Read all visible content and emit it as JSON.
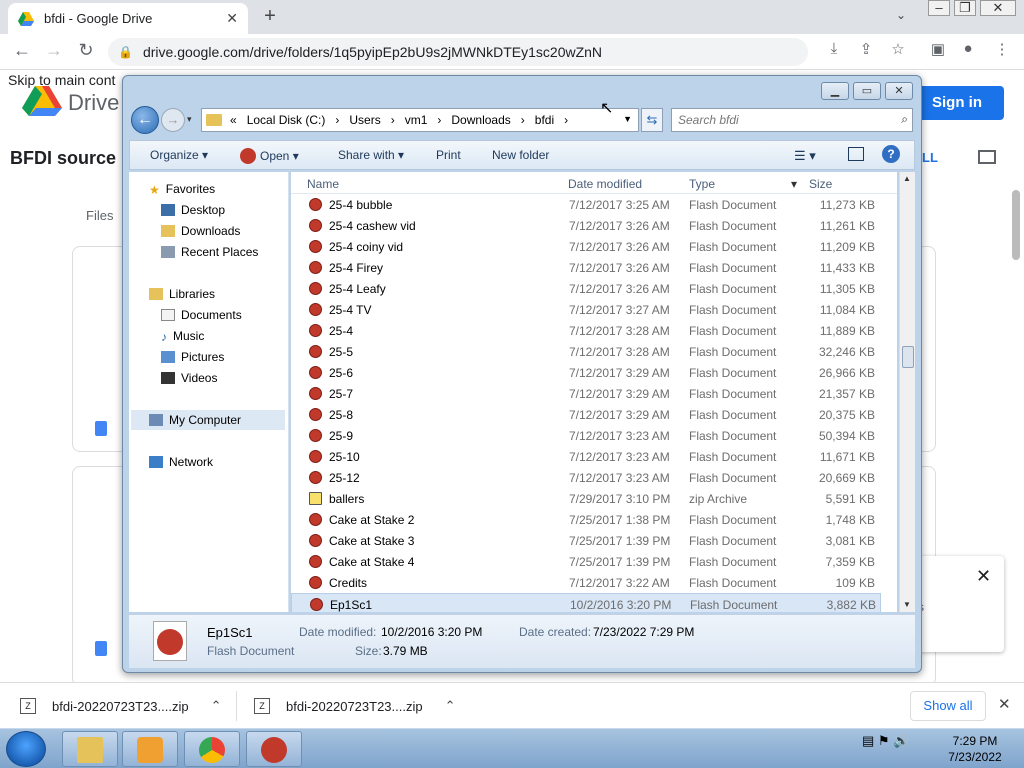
{
  "browser": {
    "tab_title": "bfdi - Google Drive",
    "url": "drive.google.com/drive/folders/1q5pyipEp2bU9s2jMWNkDTEy1sc20wZnN"
  },
  "drive": {
    "skip_link": "Skip to main cont",
    "logo_text": "Drive",
    "sign_in": "Sign in",
    "folder_title": "BFDI source",
    "files_label": "Files",
    "view_all": "LL",
    "popup_text": "s"
  },
  "downloads": {
    "items": [
      "bfdi-20220723T23....zip",
      "bfdi-20220723T23....zip"
    ],
    "show_all": "Show all"
  },
  "explorer": {
    "breadcrumb": [
      "Local Disk (C:)",
      "Users",
      "vm1",
      "Downloads",
      "bfdi"
    ],
    "search_placeholder": "Search bfdi",
    "commands": {
      "organize": "Organize ▾",
      "open": "Open ▾",
      "share": "Share with ▾",
      "print": "Print",
      "new_folder": "New folder"
    },
    "nav": {
      "favorites": "Favorites",
      "desktop": "Desktop",
      "downloads": "Downloads",
      "recent": "Recent Places",
      "libraries": "Libraries",
      "documents": "Documents",
      "music": "Music",
      "pictures": "Pictures",
      "videos": "Videos",
      "computer": "My Computer",
      "network": "Network"
    },
    "columns": {
      "name": "Name",
      "date": "Date modified",
      "type": "Type",
      "size": "Size"
    },
    "files": [
      {
        "name": "25-4 bubble",
        "date": "7/12/2017 3:25 AM",
        "type": "Flash Document",
        "size": "11,273 KB"
      },
      {
        "name": "25-4 cashew vid",
        "date": "7/12/2017 3:26 AM",
        "type": "Flash Document",
        "size": "11,261 KB"
      },
      {
        "name": "25-4 coiny vid",
        "date": "7/12/2017 3:26 AM",
        "type": "Flash Document",
        "size": "11,209 KB"
      },
      {
        "name": "25-4 Firey",
        "date": "7/12/2017 3:26 AM",
        "type": "Flash Document",
        "size": "11,433 KB"
      },
      {
        "name": "25-4 Leafy",
        "date": "7/12/2017 3:26 AM",
        "type": "Flash Document",
        "size": "11,305 KB"
      },
      {
        "name": "25-4 TV",
        "date": "7/12/2017 3:27 AM",
        "type": "Flash Document",
        "size": "11,084 KB"
      },
      {
        "name": "25-4",
        "date": "7/12/2017 3:28 AM",
        "type": "Flash Document",
        "size": "11,889 KB"
      },
      {
        "name": "25-5",
        "date": "7/12/2017 3:28 AM",
        "type": "Flash Document",
        "size": "32,246 KB"
      },
      {
        "name": "25-6",
        "date": "7/12/2017 3:29 AM",
        "type": "Flash Document",
        "size": "26,966 KB"
      },
      {
        "name": "25-7",
        "date": "7/12/2017 3:29 AM",
        "type": "Flash Document",
        "size": "21,357 KB"
      },
      {
        "name": "25-8",
        "date": "7/12/2017 3:29 AM",
        "type": "Flash Document",
        "size": "20,375 KB"
      },
      {
        "name": "25-9",
        "date": "7/12/2017 3:23 AM",
        "type": "Flash Document",
        "size": "50,394 KB"
      },
      {
        "name": "25-10",
        "date": "7/12/2017 3:23 AM",
        "type": "Flash Document",
        "size": "11,671 KB"
      },
      {
        "name": "25-12",
        "date": "7/12/2017 3:23 AM",
        "type": "Flash Document",
        "size": "20,669 KB"
      },
      {
        "name": "ballers",
        "date": "7/29/2017 3:10 PM",
        "type": "zip Archive",
        "size": "5,591 KB"
      },
      {
        "name": "Cake at Stake 2",
        "date": "7/25/2017 1:38 PM",
        "type": "Flash Document",
        "size": "1,748 KB"
      },
      {
        "name": "Cake at Stake 3",
        "date": "7/25/2017 1:39 PM",
        "type": "Flash Document",
        "size": "3,081 KB"
      },
      {
        "name": "Cake at Stake 4",
        "date": "7/25/2017 1:39 PM",
        "type": "Flash Document",
        "size": "7,359 KB"
      },
      {
        "name": "Credits",
        "date": "7/12/2017 3:22 AM",
        "type": "Flash Document",
        "size": "109 KB"
      },
      {
        "name": "Ep1Sc1",
        "date": "10/2/2016 3:20 PM",
        "type": "Flash Document",
        "size": "3,882 KB"
      }
    ],
    "details": {
      "name": "Ep1Sc1",
      "type": "Flash Document",
      "modified_label": "Date modified:",
      "modified": "10/2/2016 3:20 PM",
      "created_label": "Date created:",
      "created": "7/23/2022 7:29 PM",
      "size_label": "Size:",
      "size": "3.79 MB"
    }
  },
  "taskbar": {
    "time": "7:29 PM",
    "date": "7/23/2022"
  }
}
